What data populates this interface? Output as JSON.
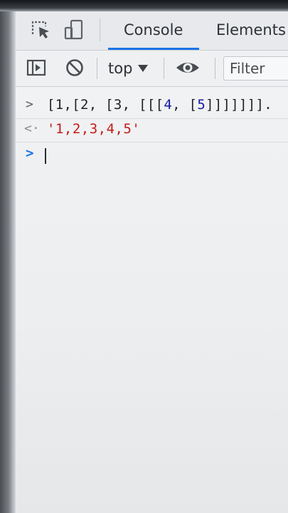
{
  "tabs": {
    "console": "Console",
    "elements": "Elements"
  },
  "toolbar": {
    "context": "top",
    "filter_placeholder": "Filter"
  },
  "console": {
    "prompt_symbol": ">",
    "result_symbol": "<·",
    "input_prefix": "[1,[2, [3, [[[",
    "input_n4": "4",
    "input_mid": ", [",
    "input_n5": "5",
    "input_suffix": "]]]]]]].",
    "result": "'1,2,3,4,5'"
  },
  "colors": {
    "accent": "#1a73e8",
    "string": "#c41a16"
  }
}
